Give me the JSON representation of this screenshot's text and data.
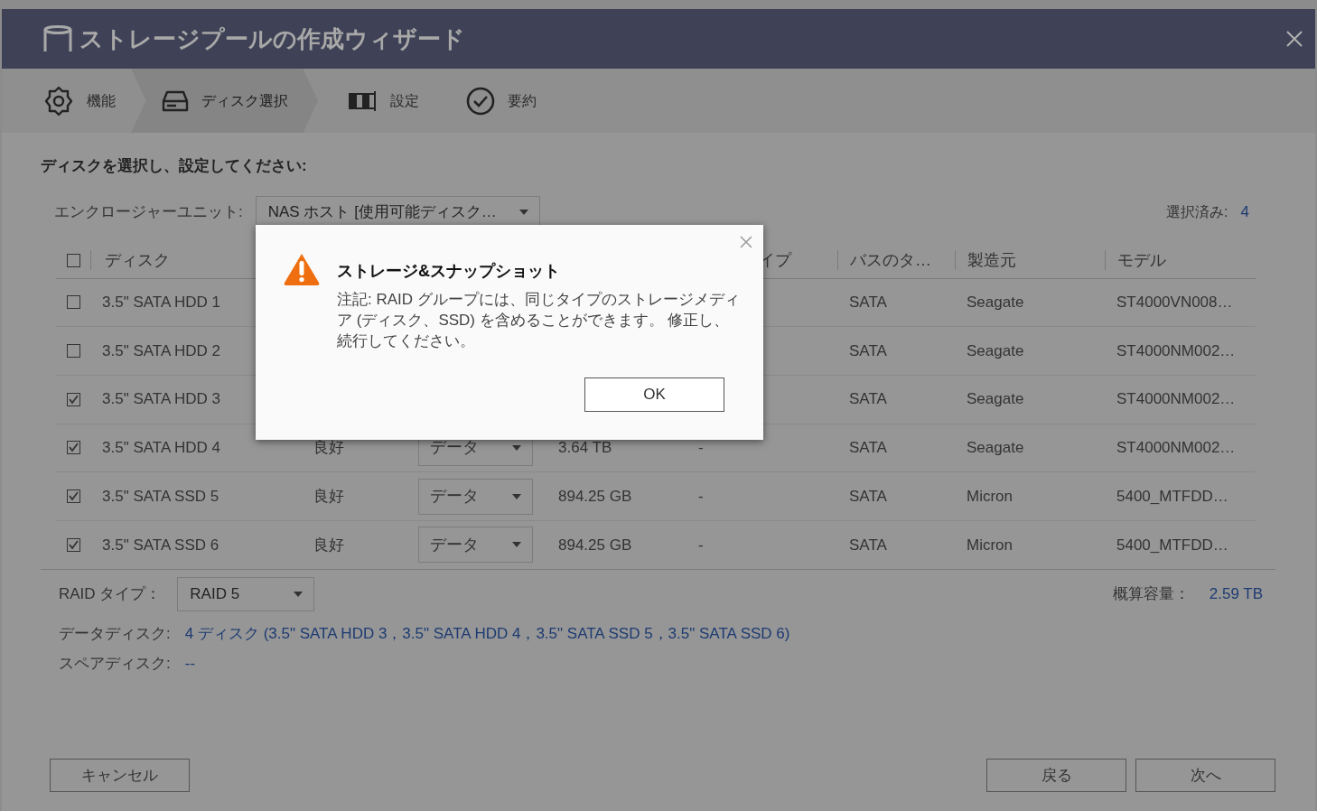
{
  "window": {
    "title": "ストレージプールの作成ウィザード"
  },
  "steps": [
    {
      "label": "機能",
      "selected": false,
      "kind": "gear"
    },
    {
      "label": "ディスク選択",
      "selected": true,
      "kind": "disk"
    },
    {
      "label": "設定",
      "selected": false,
      "kind": "settings"
    },
    {
      "label": "要約",
      "selected": false,
      "kind": "check"
    }
  ],
  "instruction": "ディスクを選択し、設定してください:",
  "enclosure": {
    "label": "エンクロージャーユニット:",
    "value": "NAS ホスト [使用可能ディスク…"
  },
  "selected_count": {
    "label": "選択済み:",
    "value": "4"
  },
  "table": {
    "all_checked": false,
    "columns": [
      "ディスク",
      "イプ",
      "バスのタ…",
      "製造元",
      "モデル"
    ],
    "rows": [
      {
        "checked": false,
        "disk": "3.5\" SATA HDD 1",
        "bus": "SATA",
        "maker": "Seagate",
        "model": "ST4000VN008…"
      },
      {
        "checked": false,
        "disk": "3.5\" SATA HDD 2",
        "bus": "SATA",
        "maker": "Seagate",
        "model": "ST4000NM002…"
      },
      {
        "checked": true,
        "disk": "3.5\" SATA HDD 3",
        "bus": "SATA",
        "maker": "Seagate",
        "model": "ST4000NM002…"
      },
      {
        "checked": true,
        "disk": "3.5\" SATA HDD 4",
        "status": "良好",
        "type": "データ",
        "capacity": "3.64 TB",
        "column_5": "-",
        "bus": "SATA",
        "maker": "Seagate",
        "model": "ST4000NM002…"
      },
      {
        "checked": true,
        "disk": "3.5\" SATA SSD 5",
        "status": "良好",
        "type": "データ",
        "capacity": "894.25 GB",
        "column_5": "-",
        "bus": "SATA",
        "maker": "Micron",
        "model": "5400_MTFDD…"
      },
      {
        "checked": true,
        "disk": "3.5\" SATA SSD 6",
        "status": "良好",
        "type": "データ",
        "capacity": "894.25 GB",
        "column_5": "-",
        "bus": "SATA",
        "maker": "Micron",
        "model": "5400_MTFDD…"
      }
    ]
  },
  "raid_type": {
    "label": "RAID タイプ：",
    "value": "RAID 5"
  },
  "capacity": {
    "label": "概算容量：",
    "value": "2.59 TB"
  },
  "data_disks": {
    "label": "データディスク:",
    "value": "4 ディスク (3.5\" SATA HDD 3，3.5\" SATA HDD 4，3.5\" SATA SSD 5，3.5\" SATA SSD 6)"
  },
  "spare_disks": {
    "label": "スペアディスク:",
    "value": "--"
  },
  "buttons": {
    "cancel": "キャンセル",
    "back": "戻る",
    "next": "次へ"
  },
  "alert": {
    "title": "ストレージ&スナップショット",
    "message": "注記: RAID グループには、同じタイプのストレージメディア (ディスク、SSD) を含めることができます。 修正し、続行してください。",
    "button": "OK"
  }
}
